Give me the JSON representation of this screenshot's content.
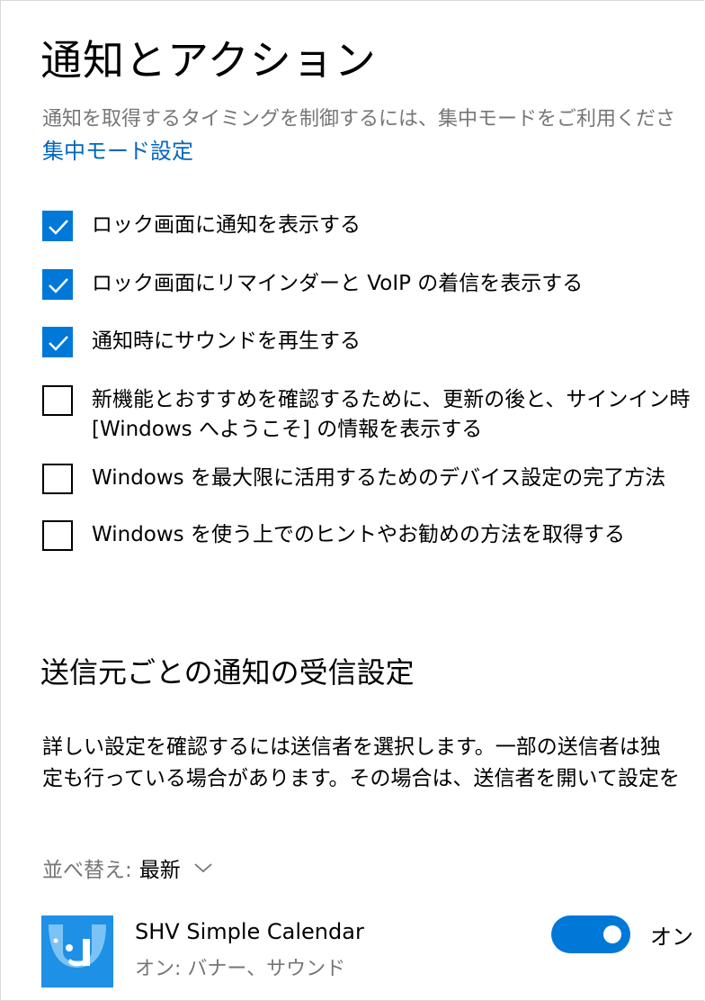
{
  "header": {
    "title": "通知とアクション",
    "intro": "通知を取得するタイミングを制御するには、集中モードをご利用くださ",
    "focus_link": "集中モード設定"
  },
  "checkboxes": [
    {
      "lines": [
        "ロック画面に通知を表示する"
      ],
      "checked": true
    },
    {
      "lines": [
        "ロック画面にリマインダーと VoIP の着信を表示する"
      ],
      "checked": true
    },
    {
      "lines": [
        "通知時にサウンドを再生する"
      ],
      "checked": true
    },
    {
      "lines": [
        "新機能とおすすめを確認するために、更新の後と、サインイン時",
        "[Windows へようこそ] の情報を表示する"
      ],
      "checked": false
    },
    {
      "lines": [
        "Windows を最大限に活用するためのデバイス設定の完了方法"
      ],
      "checked": false
    },
    {
      "lines": [
        "Windows を使う上でのヒントやお勧めの方法を取得する"
      ],
      "checked": false
    }
  ],
  "senders": {
    "title": "送信元ごとの通知の受信設定",
    "desc_line1": "詳しい設定を確認するには送信者を選択します。一部の送信者は独",
    "desc_line2": "定も行っている場合があります。その場合は、送信者を開いて設定を",
    "sort_label": "並べ替え:",
    "sort_value": "最新",
    "apps": [
      {
        "name": "SHV Simple Calendar",
        "status": "オン: バナー、サウンド",
        "toggle_on": true,
        "toggle_text": "オン",
        "icon": "calendar-app-icon"
      }
    ]
  },
  "colors": {
    "accent": "#0078d7",
    "link": "#0067c0",
    "secondary_text": "#767676",
    "app_icon_bg": "#1e90e6"
  }
}
